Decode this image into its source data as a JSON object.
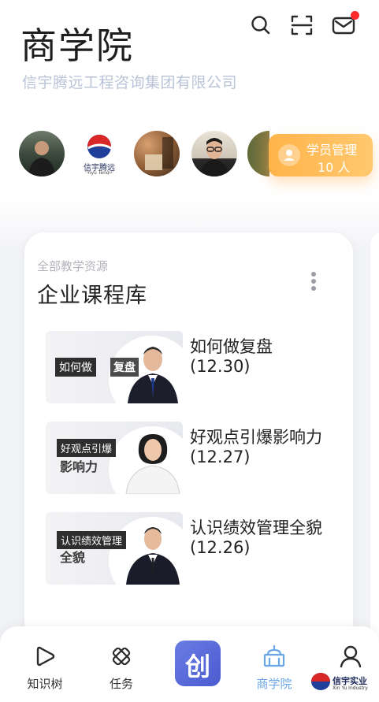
{
  "header": {
    "title": "商学院",
    "subtitle": "信宇腾远工程咨询集团有限公司",
    "icons": [
      "search-icon",
      "scan-icon",
      "mail-icon"
    ],
    "has_notification": true
  },
  "avatars": {
    "brand_logo_text": "信宇腾远",
    "brand_logo_sub": "Xinyu Tengyu"
  },
  "student_manage": {
    "label": "学员管理",
    "count": "10 人",
    "color": "#ffb44a"
  },
  "card": {
    "label": "全部教学资源",
    "title": "企业课程库",
    "courses": [
      {
        "title": "如何做复盘",
        "date": "(12.30)",
        "thumb_tag": "如何做",
        "thumb_tag2": "复盘"
      },
      {
        "title": "好观点引爆影响力",
        "date": "(12.27)",
        "thumb_tag": "好观点引爆",
        "thumb_tag2": "影响力"
      },
      {
        "title": "认识绩效管理全貌",
        "date": "(12.26)",
        "thumb_tag": "认识绩效管理",
        "thumb_tag2": "全貌"
      }
    ]
  },
  "nav": {
    "items": [
      {
        "label": "知识树",
        "icon": "play-icon"
      },
      {
        "label": "任务",
        "icon": "task-icon"
      },
      {
        "label": "创",
        "icon": "create-icon"
      },
      {
        "label": "商学院",
        "icon": "school-icon",
        "active": true
      },
      {
        "label": "",
        "icon": "profile-icon"
      }
    ],
    "active_color": "#6aa6e8"
  },
  "watermark": {
    "text": "信宇实业",
    "sub": "Xin Yu Industry"
  }
}
